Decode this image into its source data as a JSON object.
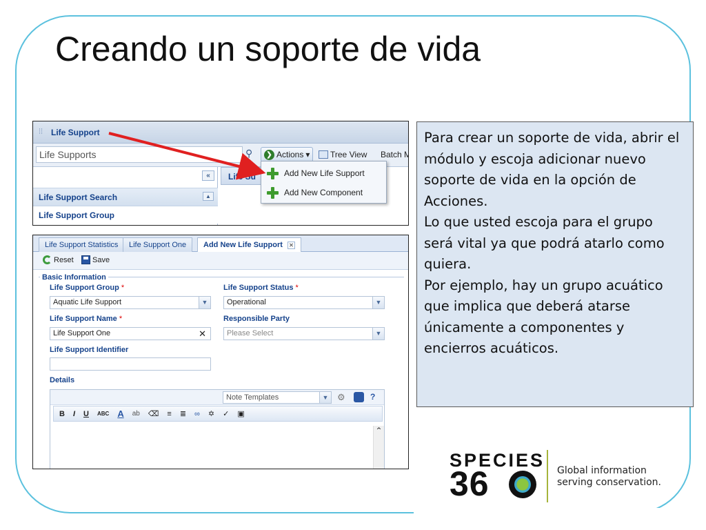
{
  "slide": {
    "title": "Creando un soporte de vida"
  },
  "screenshot_top": {
    "panel_title": "Life Support",
    "search_placeholder": "Life Supports",
    "actions_label": "Actions",
    "tree_view_label": "Tree View",
    "batch_label": "Batch M",
    "collapse_label": "«",
    "accordion": [
      "Life Support Search",
      "Life Support Group"
    ],
    "tab_label": "Life Su",
    "menu_items": [
      "Add New Life Support",
      "Add New Component"
    ]
  },
  "screenshot_form": {
    "tabs": [
      "Life Support Statistics",
      "Life Support One",
      "Add New Life Support"
    ],
    "toolbar": {
      "reset": "Reset",
      "save": "Save"
    },
    "section": "Basic Information",
    "fields": {
      "group_label": "Life Support Group",
      "group_value": "Aquatic Life Support",
      "status_label": "Life Support Status",
      "status_value": "Operational",
      "name_label": "Life Support Name",
      "name_value": "Life Support One",
      "party_label": "Responsible Party",
      "party_placeholder": "Please Select",
      "identifier_label": "Life Support Identifier",
      "details_label": "Details",
      "note_templates": "Note Templates"
    },
    "required_mark": "*",
    "editor_buttons": [
      "B",
      "I",
      "U",
      "ABC",
      "A",
      "ab",
      "≡",
      "≣",
      "∞"
    ]
  },
  "instructions": {
    "paragraphs": [
      "Para crear un soporte de vida, abrir el módulo y escoja adicionar nuevo soporte de vida en la opción de Acciones.",
      "Lo que usted escoja para el grupo será vital ya que podrá atarlo como quiera.",
      "Por ejemplo, hay un grupo acuático que implica que deberá atarse únicamente a componentes y encierros acuáticos."
    ]
  },
  "logo": {
    "word1": "SPECIES",
    "word2": "36",
    "tagline_line1": "Global information",
    "tagline_line2": "serving conservation."
  },
  "colors": {
    "frame": "#5bc1de",
    "textbox_bg": "#dce6f2",
    "arrow": "#e02020",
    "ext_blue": "#15428b"
  }
}
